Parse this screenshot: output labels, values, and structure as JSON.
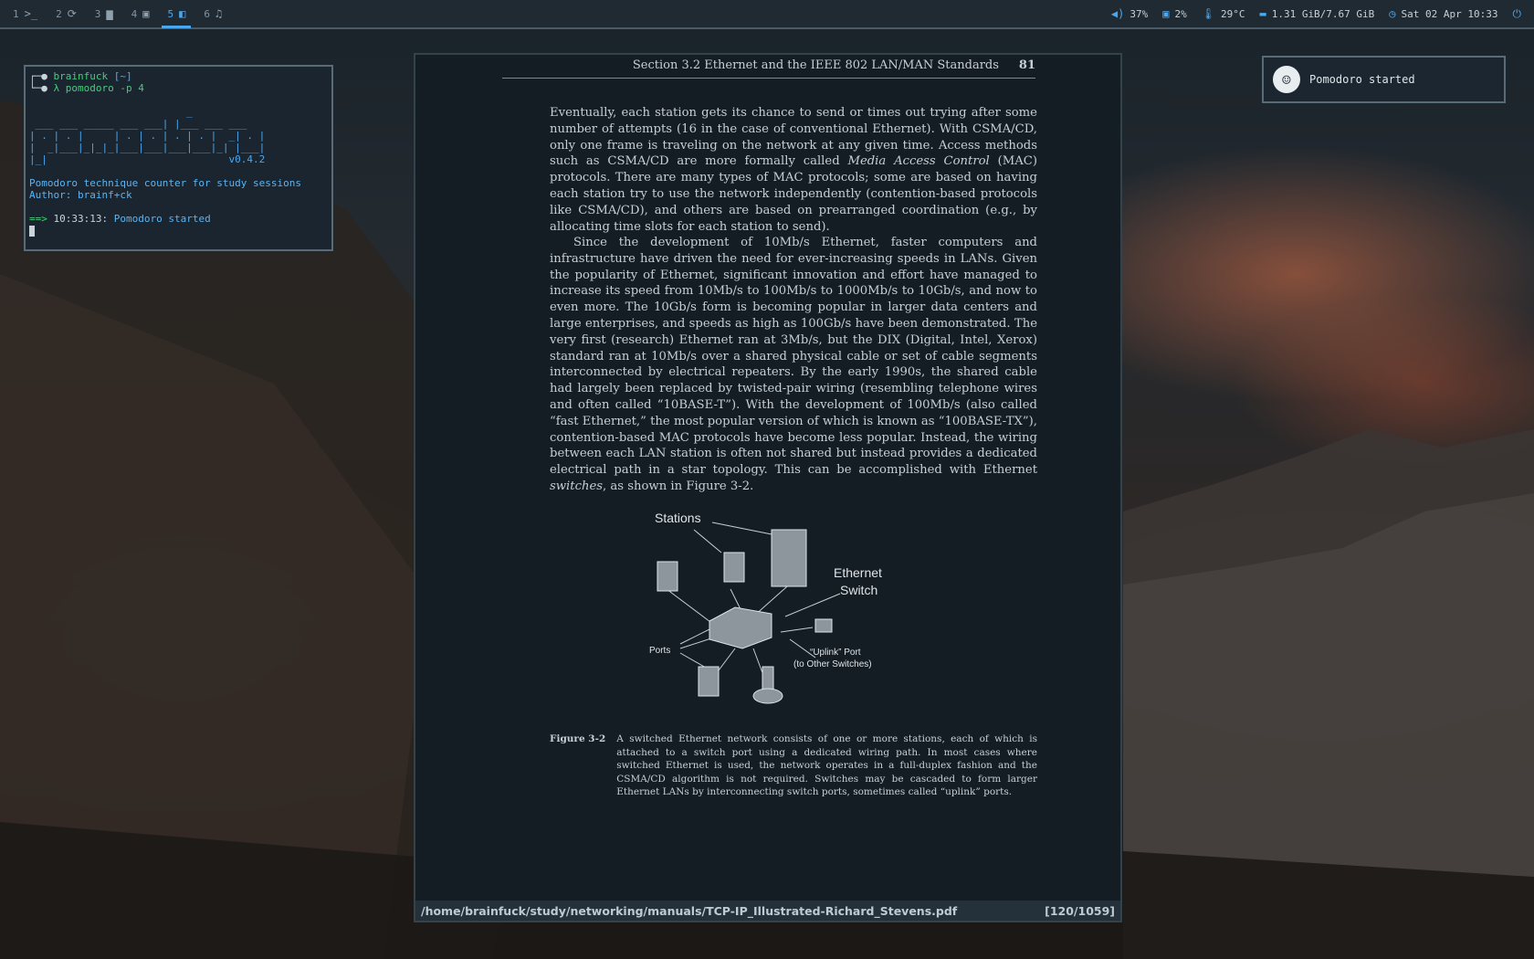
{
  "topbar": {
    "workspaces": [
      {
        "num": "1",
        "icon": "terminal-icon",
        "glyph": ">_"
      },
      {
        "num": "2",
        "icon": "refresh-icon",
        "glyph": "⟳"
      },
      {
        "num": "3",
        "icon": "folder-icon",
        "glyph": "▆"
      },
      {
        "num": "4",
        "icon": "panel-icon",
        "glyph": "▣"
      },
      {
        "num": "5",
        "icon": "book-icon",
        "glyph": "◧"
      },
      {
        "num": "6",
        "icon": "music-icon",
        "glyph": "♫"
      }
    ],
    "active_workspace": "5",
    "status": {
      "volume": "37%",
      "cpu": "2%",
      "temperature": "29°C",
      "memory": "1.31 GiB/7.67 GiB",
      "datetime": "Sat 02 Apr 10:33"
    },
    "accent": "#4aa8f0"
  },
  "terminal": {
    "prompt_user": "brainfuck",
    "prompt_dir": "[~]",
    "command": "λ pomodoro -p 4",
    "ascii_art": [
      "                          _",
      " ___ ___ _____ ___ ___| |___ ___ ___",
      "| . | . |     | . | . | . | . |  _| . |",
      "|  _|___|_|_|_|___|___|___|___|_| |___|",
      "|_|                              v0.4.2"
    ],
    "description": "Pomodoro technique counter for study sessions",
    "author": "Author: brainf+ck",
    "log_prefix": "==>",
    "log_time": "10:33:13:",
    "log_message": "Pomodoro started"
  },
  "viewer": {
    "running_head": "Section 3.2  Ethernet and the IEEE 802 LAN/MAN Standards",
    "page_number": "81",
    "paragraph1_a": "Eventually, each station gets its chance to send or times out trying after some number of attempts (16 in the case of conventional Ethernet). With CSMA/CD, only one frame is traveling on the network at any given time. Access methods such as CSMA/CD are more formally called ",
    "paragraph1_em": "Media Access Control",
    "paragraph1_b": " (MAC) protocols. There are many types of MAC protocols; some are based on having each station try to use the network independently (contention-based protocols like CSMA/CD), and others are based on prearranged coordination (e.g., by allocating time slots for each station to send).",
    "paragraph2_a": "Since the development of 10Mb/s Ethernet, faster computers and infrastructure have driven the need for ever-increasing speeds in LANs. Given the popularity of Ethernet, significant innovation and effort have managed to increase its speed from 10Mb/s to 100Mb/s to 1000Mb/s to 10Gb/s, and now to even more. The 10Gb/s form is becoming popular in larger data centers and large enterprises, and speeds as high as 100Gb/s have been demonstrated. The very first (research) Ethernet ran at 3Mb/s, but the DIX (Digital, Intel, Xerox) standard ran at 10Mb/s over a shared physical cable or set of cable segments interconnected by electrical repeaters. By the early 1990s, the shared cable had largely been replaced by twisted-pair wiring (resembling telephone wires and often called “10BASE-T”). With the development of 100Mb/s (also called “fast Ethernet,” the most popular version of which is known as “100BASE-TX”), contention-based MAC protocols have become less popular. Instead, the wiring between each LAN station is often not shared but instead provides a dedicated electrical path in a star topology. This can be accomplished with Ethernet ",
    "paragraph2_em": "switches",
    "paragraph2_b": ", as shown in Figure 3-2.",
    "figure": {
      "label_stations": "Stations",
      "label_ethernet": "Ethernet",
      "label_switch": "Switch",
      "label_ports": "Ports",
      "label_uplink1": "“Uplink” Port",
      "label_uplink2": "(to Other Switches)"
    },
    "caption_label": "Figure 3-2",
    "caption_text": "A switched Ethernet network consists of one or more stations, each of which is attached to a switch port using a dedicated wiring path. In most cases where switched Ethernet is used, the network operates in a full-duplex fashion and the CSMA/CD algorithm is not required. Switches may be cascaded to form larger Ethernet LANs by interconnecting switch ports, sometimes called “uplink” ports.",
    "file_path": "/home/brainfuck/study/networking/manuals/TCP-IP_Illustrated-Richard_Stevens.pdf",
    "page_indicator": "[120/1059]"
  },
  "notification": {
    "icon": "pomodoro-icon",
    "message": "Pomodoro started"
  }
}
